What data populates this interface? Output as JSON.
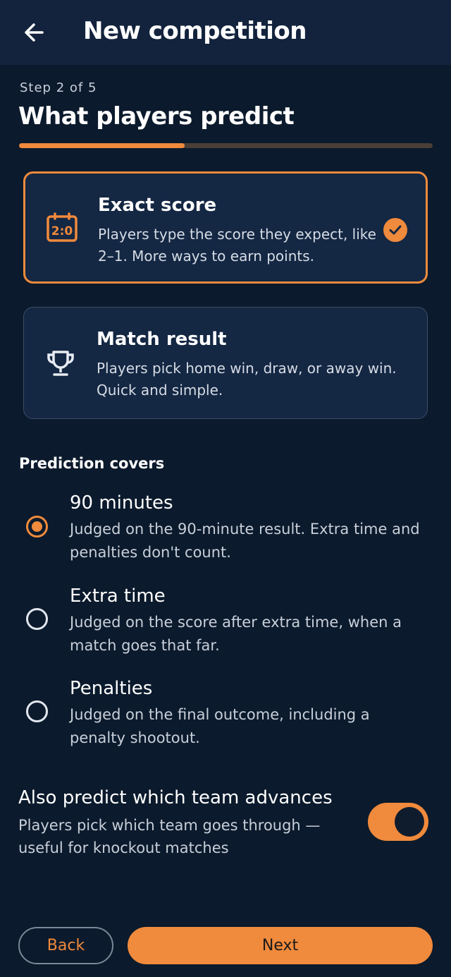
{
  "header": {
    "title": "New competition",
    "back_icon": "arrow-left-icon"
  },
  "step": {
    "label": "Step 2 of 5",
    "heading": "What players predict",
    "progress": 0.4
  },
  "colors": {
    "accent": "#f08a3c",
    "background": "#0b1a2c",
    "card": "#142743",
    "header": "#13233d"
  },
  "options": [
    {
      "title": "Exact score",
      "desc": "Players type the score they expect, like 2–1. More ways to earn points.",
      "icon": "scoreboard-icon",
      "selected": true
    },
    {
      "title": "Match result",
      "desc": "Players pick home win, draw, or away win. Quick and simple.",
      "icon": "trophy-icon",
      "selected": false
    }
  ],
  "scoreboard_text": "2:0",
  "coverage": {
    "label": "Prediction covers",
    "items": [
      {
        "title": "90 minutes",
        "desc": "Judged on the 90-minute result. Extra time and penalties don't count.",
        "selected": true
      },
      {
        "title": "Extra time",
        "desc": "Judged on the score after extra time, when a match goes that far.",
        "selected": false
      },
      {
        "title": "Penalties",
        "desc": "Judged on the final outcome, including a penalty shootout.",
        "selected": false
      }
    ]
  },
  "advance": {
    "title": "Also predict which team advances",
    "desc": "Players pick which team goes through — useful for knockout matches",
    "enabled": true
  },
  "footer": {
    "back_label": "Back",
    "next_label": "Next"
  }
}
